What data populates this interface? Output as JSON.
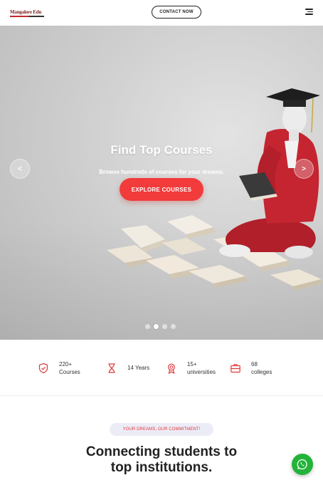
{
  "header": {
    "logo_text": "Mangalore Edu",
    "contact_label": "CONTACT NOW"
  },
  "hero": {
    "title": "Find Top Courses",
    "subtitle": "Browse hundreds of courses for your dreams.",
    "cta_label": "EXPLORE COURSES",
    "prev_label": "<",
    "next_label": ">",
    "slides_total": 4,
    "active_slide": 2
  },
  "stats": [
    {
      "icon": "shield-check-icon",
      "label": "220+ Courses"
    },
    {
      "icon": "hourglass-icon",
      "label": "14 Years"
    },
    {
      "icon": "award-ribbon-icon",
      "label": "15+ universities"
    },
    {
      "icon": "briefcase-icon",
      "label": "68 colleges"
    }
  ],
  "section": {
    "badge": "YOUR DREAMS, OUR COMMITMENT!",
    "title_line1": "Connecting students to",
    "title_line2": "top institutions."
  },
  "colors": {
    "accent": "#f23b3b",
    "whatsapp": "#23b33a",
    "badge_bg": "#ececf7"
  }
}
